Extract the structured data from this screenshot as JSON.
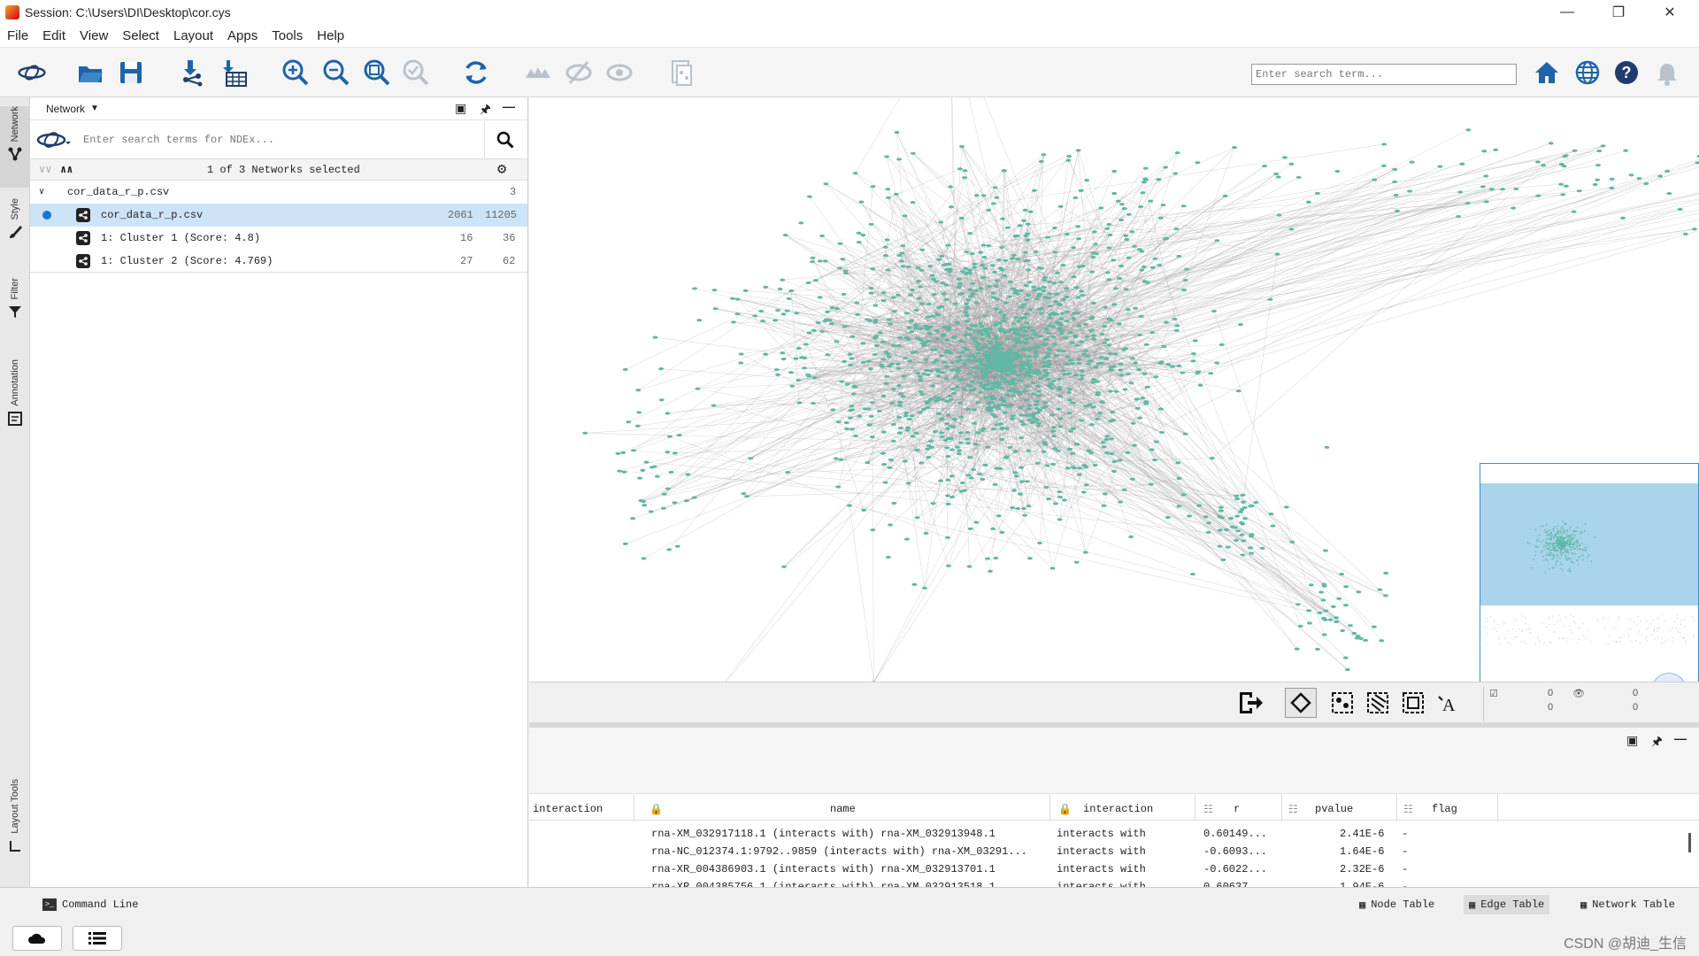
{
  "window": {
    "title": "Session: C:\\Users\\DI\\Desktop\\cor.cys"
  },
  "menu": [
    "File",
    "Edit",
    "View",
    "Select",
    "Layout",
    "Apps",
    "Tools",
    "Help"
  ],
  "toolbar": {
    "search_placeholder": "Enter search term..."
  },
  "vtabs": {
    "network": "Network",
    "style": "Style",
    "filter": "Filter",
    "annotation": "Annotation",
    "layout_tools": "Layout Tools"
  },
  "network_panel": {
    "header": "Network",
    "ndex_placeholder": "Enter search terms for NDEx...",
    "selection_summary": "1 of 3 Networks selected",
    "collection": {
      "name": "cor_data_r_p.csv",
      "count": "3"
    },
    "networks": [
      {
        "name": "cor_data_r_p.csv",
        "nodes": "2061",
        "edges": "11205"
      },
      {
        "name": "1: Cluster 1 (Score: 4.8)",
        "nodes": "16",
        "edges": "36"
      },
      {
        "name": "1: Cluster 2 (Score: 4.769)",
        "nodes": "27",
        "edges": "62"
      }
    ]
  },
  "selection_counts": {
    "nodes_selected": "0",
    "nodes_total": "0",
    "edges_selected": "0",
    "edges_total": "0"
  },
  "edge_table": {
    "columns": [
      "interaction",
      "name",
      "interaction",
      "r",
      "pvalue",
      "flag"
    ],
    "rows": [
      {
        "name": "rna-XM_032917118.1 (interacts with) rna-XM_032913948.1",
        "interaction": "interacts with",
        "r": "0.60149...",
        "pvalue": "2.41E-6",
        "flag": "-"
      },
      {
        "name": "rna-NC_012374.1:9792..9859 (interacts with) rna-XM_03291...",
        "interaction": "interacts with",
        "r": "-0.6093...",
        "pvalue": "1.64E-6",
        "flag": "-"
      },
      {
        "name": "rna-XR_004386903.1 (interacts with) rna-XM_032913701.1",
        "interaction": "interacts with",
        "r": "-0.6022...",
        "pvalue": "2.32E-6",
        "flag": "-"
      },
      {
        "name": "rna-XR_004385756.1 (interacts with) rna-XM_032913518.1",
        "interaction": "interacts with",
        "r": "0.60637...",
        "pvalue": "1.94E-6",
        "flag": "-"
      }
    ]
  },
  "bottom": {
    "command_line": "Command Line",
    "tabs": [
      "Node Table",
      "Edge Table",
      "Network Table"
    ],
    "watermark": "CSDN @胡迪_生信"
  },
  "colors": {
    "node": "#5fb8a4",
    "edge": "#9a9a9a",
    "selected_row": "#cde4f7",
    "overview_view": "#a9d4ea"
  }
}
